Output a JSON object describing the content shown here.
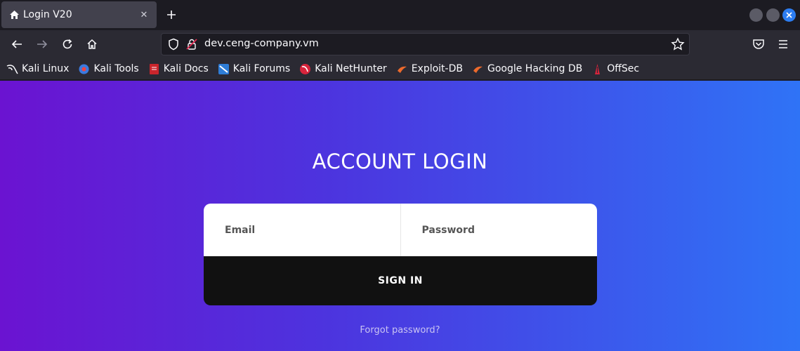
{
  "browser": {
    "tab": {
      "title": "Login V20",
      "favicon": "home-icon",
      "close": "✕"
    },
    "new_tab": "+",
    "url": "dev.ceng-company.vm",
    "bookmarks": [
      {
        "label": "Kali Linux",
        "icon": "kali-dragon-icon"
      },
      {
        "label": "Kali Tools",
        "icon": "kali-tools-icon"
      },
      {
        "label": "Kali Docs",
        "icon": "kali-docs-icon"
      },
      {
        "label": "Kali Forums",
        "icon": "kali-forums-icon"
      },
      {
        "label": "Kali NetHunter",
        "icon": "nethunter-icon"
      },
      {
        "label": "Exploit-DB",
        "icon": "exploit-db-icon"
      },
      {
        "label": "Google Hacking DB",
        "icon": "ghdb-icon"
      },
      {
        "label": "OffSec",
        "icon": "offsec-icon"
      }
    ]
  },
  "login": {
    "heading": "ACCOUNT LOGIN",
    "email_placeholder": "Email",
    "password_placeholder": "Password",
    "signin_label": "SIGN IN",
    "forgot_label": "Forgot password?"
  },
  "colors": {
    "gradient_start": "#6b13d1",
    "gradient_end": "#2f73f6",
    "button_bg": "#111111",
    "accent_close": "#2c7df2"
  }
}
